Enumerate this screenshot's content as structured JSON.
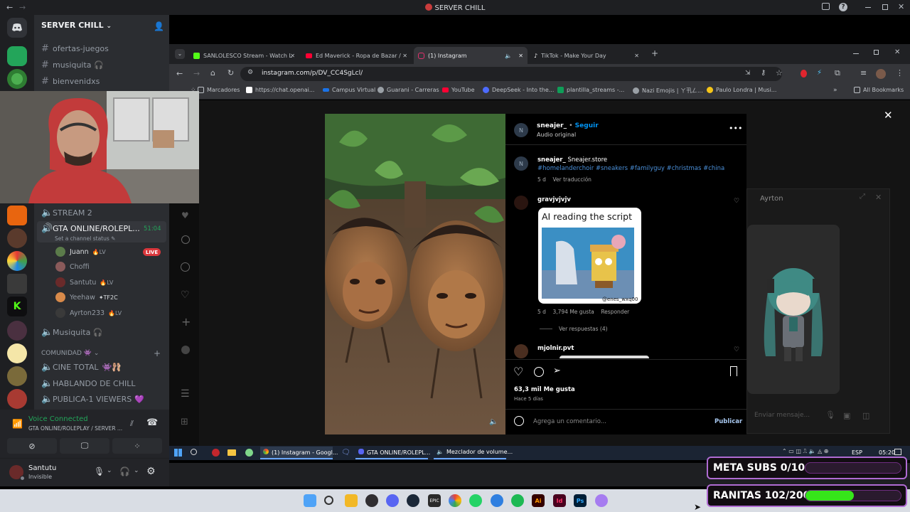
{
  "discord": {
    "window_title": "SERVER CHILL",
    "server_name": "SERVER CHILL",
    "channels_top": [
      {
        "label": "ofertas-juegos"
      },
      {
        "label": "musiquita 🎧"
      },
      {
        "label": "bienvenidxs"
      }
    ],
    "voice_channels": [
      {
        "label": "STREAM 2"
      },
      {
        "label": "GTA ONLINE/ROLEPL...",
        "timer": "51:04",
        "status": "Set a channel status"
      }
    ],
    "members": [
      {
        "name": "Juann",
        "tag": "LV",
        "live": "LIVE"
      },
      {
        "name": "Choffi",
        "tag": ""
      },
      {
        "name": "Santutu",
        "tag": "LV"
      },
      {
        "name": "Yeehaw",
        "tag": "TF2C"
      },
      {
        "name": "Ayrton233",
        "tag": "LV"
      }
    ],
    "musiquita_label": "Musiquita 🎧",
    "category_label": "COMUNIDAD",
    "community_channels": [
      {
        "label": "CINE TOTAL"
      },
      {
        "label": "HABLANDO DE CHILL"
      },
      {
        "label": "PUBLICA-1 VIEWERS"
      }
    ],
    "voice_connected": {
      "title": "Voice Connected",
      "subtitle": "GTA ONLINE/ROLEPLAY / SERVER ..."
    },
    "user": {
      "name": "Santutu",
      "status": "Invisible"
    }
  },
  "browser": {
    "tabs": [
      {
        "label": "SANLOLESCO Stream - Watch L",
        "color": "#53fc18"
      },
      {
        "label": "Ed Maverick - Ropa de Bazar /",
        "color": "#ff0033"
      },
      {
        "label": "(1) Instagram",
        "color": "#e1306c"
      },
      {
        "label": "TikTok - Make Your Day",
        "color": "#000000"
      }
    ],
    "url": "instagram.com/p/DV_CC4SgLcl/",
    "bookmarks": [
      {
        "label": "Marcadores"
      },
      {
        "label": "https://chat.openai..."
      },
      {
        "label": "Campus Virtual"
      },
      {
        "label": "Guarani - Carreras"
      },
      {
        "label": "YouTube"
      },
      {
        "label": "DeepSeek - Into the..."
      },
      {
        "label": "plantilla_streams -..."
      },
      {
        "label": "Nazi Emojis | ㄚ卂ㄥ..."
      },
      {
        "label": "Paulo Londra | Musi..."
      }
    ],
    "all_bookmarks": "All Bookmarks"
  },
  "instagram": {
    "author": "sneajer_",
    "follow": "Seguir",
    "audio": "Audio original",
    "caption_author": "sneajer_",
    "caption": "Sneajer.store",
    "hashtags": "#homelanderchoir #sneakers #familyguy #christmas #china",
    "caption_age": "5 d",
    "translate": "Ver traducción",
    "comment1_author": "gravjvjvjv",
    "meme_text": "AI reading the script",
    "meme_watermark": "@enes_wxq00",
    "comment1_age": "5 d",
    "comment1_likes": "3,794 Me gusta",
    "comment1_reply": "Responder",
    "view_replies": "Ver respuestas (4)",
    "comment2_author": "mjolnir.pvt",
    "likes": "63,3 mil Me gusta",
    "posted": "Hace 5 días",
    "comment_placeholder": "Agrega un comentario...",
    "publish": "Publicar",
    "popup_name": "Ayrton",
    "popup_input": "Enviar mensaje..."
  },
  "win_taskbar": {
    "items": [
      {
        "label": "(1) Instagram - Googl..."
      },
      {
        "label": "GTA ONLINE/ROLEPL..."
      },
      {
        "label": "Mezclador de volume..."
      }
    ],
    "lang": "ESP",
    "time": "05:20"
  },
  "overlays": {
    "meta_subs": {
      "label": "META SUBS 0/10",
      "progress": 0.0
    },
    "ranitas": {
      "label": "RANITAS 102/200",
      "progress": 0.51
    }
  },
  "colors": {
    "discord_green": "#23a55a",
    "live_red": "#da373c",
    "ig_blue": "#0095f6",
    "overlay_purple": "#b06bd3",
    "overlay_green": "#36e51a"
  }
}
